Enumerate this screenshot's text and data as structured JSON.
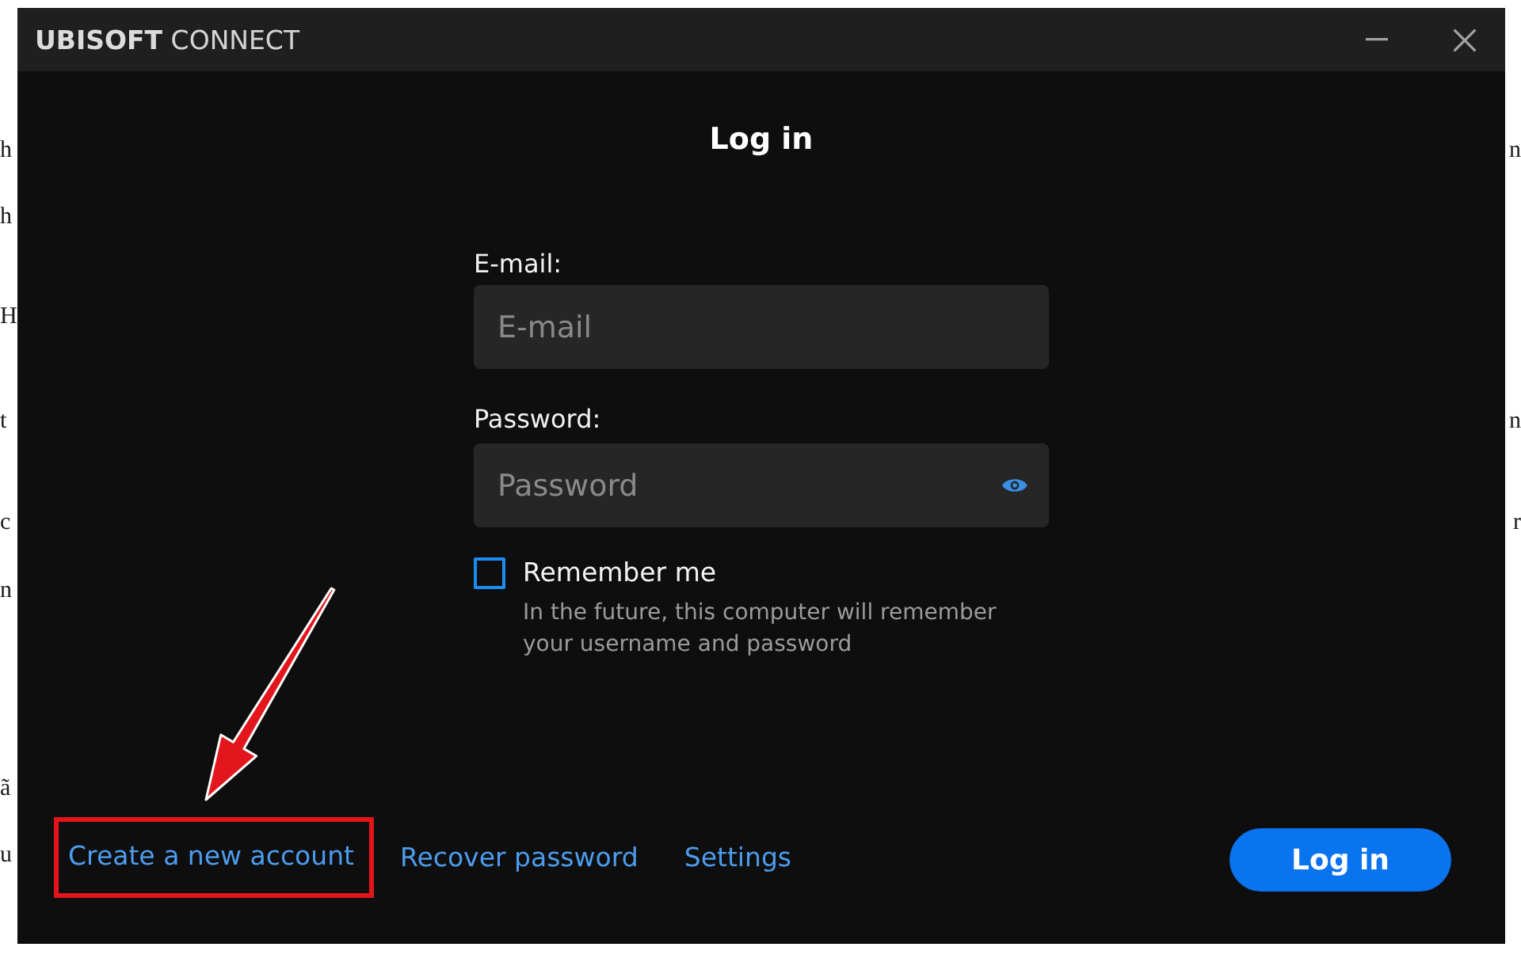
{
  "backdrop_lines": [
    {
      "left": "h",
      "right": "n"
    },
    {
      "left": "h"
    },
    {
      "left": "H"
    },
    {
      "left": "t",
      "right": "n"
    },
    {
      "left": "c",
      "right": "r"
    },
    {
      "left": "n"
    },
    {
      "left": "ã"
    },
    {
      "left": "u"
    }
  ],
  "window": {
    "title": "**UBISOFT** CONNECT"
  },
  "heading": "Log in",
  "fields": [
    {
      "kind": "email",
      "label": "E-mail:",
      "placeholder": "E-mail"
    },
    {
      "kind": "password",
      "label": "Password:",
      "placeholder": "Password"
    }
  ],
  "remember": {
    "label": "Remember me",
    "checked": false,
    "hint": "In the future, this computer will remember your username and password"
  },
  "links": [
    {
      "label": "Create a new account",
      "highlighted": true
    },
    {
      "label": "Recover password",
      "highlighted": false
    },
    {
      "label": "Settings",
      "highlighted": false
    }
  ],
  "submit": "Log in"
}
